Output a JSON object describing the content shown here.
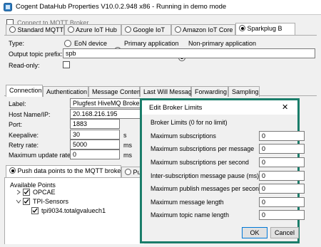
{
  "app": {
    "title": "Cogent DataHub Properties V10.0.2.948 x86 - Running in demo mode"
  },
  "connect": {
    "label": "Connect to MQTT Broker",
    "checked": false
  },
  "broker_types": [
    {
      "label": "Standard MQTT",
      "selected": false
    },
    {
      "label": "Azure IoT Hub",
      "selected": false
    },
    {
      "label": "Google IoT",
      "selected": false
    },
    {
      "label": "Amazon IoT Core",
      "selected": false
    },
    {
      "label": "Sparkplug B",
      "selected": true
    }
  ],
  "type_row": {
    "label": "Type:",
    "options": [
      {
        "label": "EoN device",
        "selected": false
      },
      {
        "label": "Primary application",
        "selected": false
      },
      {
        "label": "Non-primary application",
        "selected": true
      }
    ]
  },
  "output_prefix": {
    "label": "Output topic prefix:",
    "value": "spb"
  },
  "readonly": {
    "label": "Read-only:",
    "checked": false
  },
  "tabs": [
    {
      "label": "Connection",
      "active": true
    },
    {
      "label": "Authentication",
      "active": false
    },
    {
      "label": "Message Content",
      "active": false
    },
    {
      "label": "Last Will Message",
      "active": false
    },
    {
      "label": "Forwarding",
      "active": false
    },
    {
      "label": "Sampling",
      "active": false
    }
  ],
  "connection": {
    "label_label": "Label:",
    "label_value": "Plugfest HiveMQ Broker",
    "host_label": "Host Name/IP:",
    "host_value": "20.168.216.195",
    "port_label": "Port:",
    "port_value": "1883",
    "keepalive_label": "Keepalive:",
    "keepalive_value": "30",
    "keepalive_unit": "s",
    "retry_label": "Retry rate:",
    "retry_value": "5000",
    "retry_unit": "ms",
    "maxrate_label": "Maximum update rate:",
    "maxrate_value": "0",
    "maxrate_unit": "ms"
  },
  "direction": {
    "push_label": "Push data points to the MQTT broker",
    "pull_label": "Pu"
  },
  "points": {
    "header": "Available Points",
    "items": [
      {
        "label": "OPCAE",
        "checked": true,
        "expanded": false,
        "depth": 0
      },
      {
        "label": "TPI-Sensors",
        "checked": true,
        "expanded": true,
        "depth": 0
      },
      {
        "label": "tpi9034.totalgvaluech1",
        "checked": true,
        "expanded": false,
        "depth": 1
      }
    ]
  },
  "dialog": {
    "title": "Edit Broker Limits",
    "close_glyph": "✕",
    "section": "Broker Limits (0 for no limit)",
    "rows": [
      {
        "label": "Maximum subscriptions",
        "value": "0"
      },
      {
        "label": "Maximum subscriptions per message",
        "value": "0"
      },
      {
        "label": "Maximum subscriptions per second",
        "value": "0"
      },
      {
        "label": "Inter-subscription message pause (ms)",
        "value": "0"
      },
      {
        "label": "Maximum publish messages per second",
        "value": "0"
      },
      {
        "label": "Maximum message length",
        "value": "0"
      },
      {
        "label": "Maximum topic name length",
        "value": "0"
      }
    ],
    "ok_label": "OK",
    "cancel_label": "Cancel"
  },
  "colors": {
    "dialog_border": "#1a7d6a",
    "accent": "#0078d7"
  }
}
